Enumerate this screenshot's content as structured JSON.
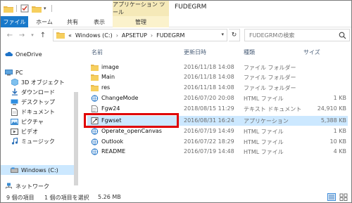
{
  "titlebar": {
    "context_tab": "アプリケーション ツール",
    "title": "FUDEGRM"
  },
  "ribbon": {
    "tabs": [
      "ファイル",
      "ホーム",
      "共有",
      "表示",
      "管理"
    ]
  },
  "address": {
    "prefix": "«",
    "segments": [
      "Windows (C:)",
      "APSETUP",
      "FUDEGRM"
    ],
    "search_placeholder": "FUDEGRMの検索"
  },
  "nav": {
    "items": [
      {
        "label": "OneDrive",
        "icon": "cloud-icon"
      },
      {
        "label": "PC",
        "icon": "pc-icon"
      },
      {
        "label": "3D オブジェクト",
        "icon": "3d-objects-icon"
      },
      {
        "label": "ダウンロード",
        "icon": "download-icon"
      },
      {
        "label": "デスクトップ",
        "icon": "desktop-icon"
      },
      {
        "label": "ドキュメント",
        "icon": "document-icon"
      },
      {
        "label": "ピクチャ",
        "icon": "picture-icon"
      },
      {
        "label": "ビデオ",
        "icon": "video-icon"
      },
      {
        "label": "ミュージック",
        "icon": "music-icon"
      },
      {
        "label": "Windows (C:)",
        "icon": "drive-icon"
      },
      {
        "label": "ネットワーク",
        "icon": "network-icon"
      }
    ]
  },
  "columns": {
    "name": "名前",
    "date": "更新日時",
    "type": "種類",
    "size": "サイズ"
  },
  "files": [
    {
      "name": "image",
      "date": "2016/11/18 14:08",
      "type": "ファイル フォルダー",
      "size": "",
      "icon": "folder-icon"
    },
    {
      "name": "Main",
      "date": "2016/11/18 14:08",
      "type": "ファイル フォルダー",
      "size": "",
      "icon": "folder-icon"
    },
    {
      "name": "res",
      "date": "2016/11/18 14:08",
      "type": "ファイル フォルダー",
      "size": "",
      "icon": "folder-icon"
    },
    {
      "name": "ChangeMode",
      "date": "2016/07/20 20:08",
      "type": "HTML ファイル",
      "size": "1 KB",
      "icon": "html-file-icon"
    },
    {
      "name": "Fgw24",
      "date": "2018/08/15 11:29",
      "type": "テキスト ドキュメント",
      "size": "24,910 KB",
      "icon": "text-file-icon"
    },
    {
      "name": "Fgwset",
      "date": "2016/08/31 16:24",
      "type": "アプリケーション",
      "size": "5,388 KB",
      "icon": "application-icon",
      "selected": true
    },
    {
      "name": "Operate_openCanvas",
      "date": "2016/07/19 14:49",
      "type": "HTML ファイル",
      "size": "1 KB",
      "icon": "html-file-icon"
    },
    {
      "name": "Outlook",
      "date": "2016/07/22 18:29",
      "type": "HTML ファイル",
      "size": "10 KB",
      "icon": "html-file-icon"
    },
    {
      "name": "README",
      "date": "2016/07/19 14:48",
      "type": "HTML ファイル",
      "size": "4 KB",
      "icon": "html-file-icon"
    }
  ],
  "status": {
    "count": "9 個の項目",
    "selected": "1 個の項目を選択",
    "size": "5.26 MB"
  },
  "colors": {
    "file_tab": "#1979ca",
    "selection": "#cce8ff",
    "context_tab": "#f5e9b8",
    "highlight_box": "#e00000"
  }
}
